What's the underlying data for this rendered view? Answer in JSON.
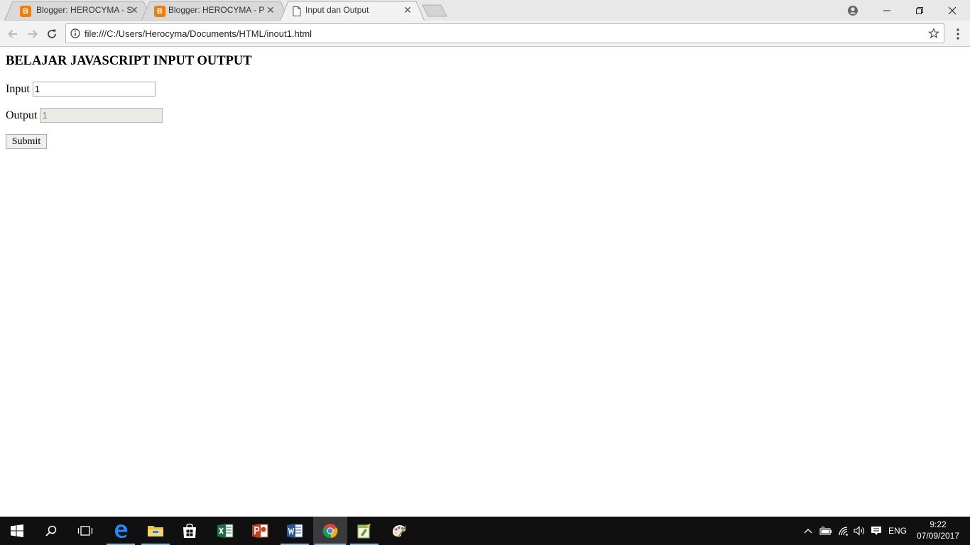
{
  "browser": {
    "tabs": [
      {
        "title": "Blogger: HEROCYMA - Se",
        "icon": "blogger-icon",
        "active": false
      },
      {
        "title": "Blogger: HEROCYMA - Pe",
        "icon": "blogger-icon",
        "active": false
      },
      {
        "title": "Input dan Output",
        "icon": "page-icon",
        "active": true
      }
    ],
    "close_glyph": "✕",
    "address_bar": {
      "url": "file:///C:/Users/Herocyma/Documents/HTML/inout1.html"
    }
  },
  "page": {
    "heading": "BELAJAR JAVASCRIPT INPUT OUTPUT",
    "input_label": "Input",
    "input_value": "1",
    "output_label": "Output",
    "output_value": "1",
    "submit_label": "Submit"
  },
  "taskbar": {
    "apps": [
      "start-icon",
      "search-icon",
      "task-view-icon",
      "edge-icon",
      "file-explorer-icon",
      "store-icon",
      "excel-icon",
      "powerpoint-icon",
      "word-icon",
      "chrome-icon",
      "notepad-plus-plus-icon",
      "paint-icon"
    ],
    "language": "ENG",
    "time": "9:22",
    "date": "07/09/2017"
  },
  "colors": {
    "taskbar_bg": "#101010",
    "accent_blue": "#76b9ed",
    "blogger_orange": "#f57d00"
  }
}
